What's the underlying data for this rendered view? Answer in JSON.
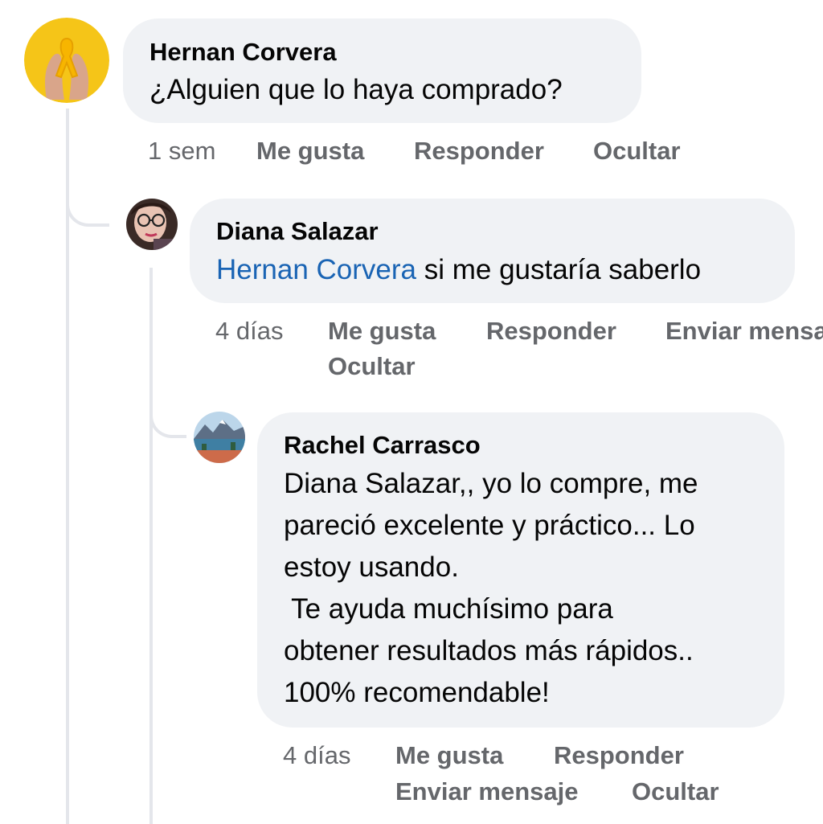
{
  "comments": [
    {
      "author": "Hernan Corvera",
      "text": "¿Alguien que lo haya comprado?",
      "time": "1 sem",
      "actions": {
        "like": "Me gusta",
        "reply": "Responder",
        "hide": "Ocultar"
      }
    },
    {
      "author": "Diana Salazar",
      "mention": "Hernan Corvera",
      "text": " si me gustaría saberlo",
      "time": "4 días",
      "actions": {
        "like": "Me gusta",
        "reply": "Responder",
        "message": "Enviar mensaje",
        "hide": "Ocultar"
      }
    },
    {
      "author": "Rachel Carrasco",
      "text_lines": [
        "Diana Salazar,, yo lo compre, me",
        "pareció excelente y práctico... Lo",
        "estoy usando.",
        " Te ayuda muchísimo para",
        "obtener resultados más rápidos..",
        "100% recomendable!"
      ],
      "time": "4 días",
      "actions": {
        "like": "Me gusta",
        "reply": "Responder",
        "message": "Enviar mensaje",
        "hide": "Ocultar"
      }
    }
  ],
  "colors": {
    "bubble": "#f0f2f5",
    "link": "#1a64b4",
    "meta": "#65676b",
    "thread_line": "#e4e6eb"
  }
}
